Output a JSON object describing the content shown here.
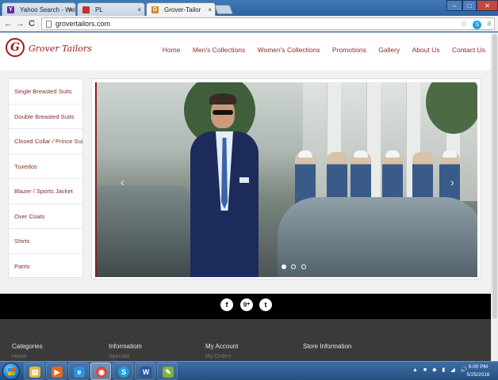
{
  "browser": {
    "tabs": [
      {
        "label": "Yahoo Search - Web Search",
        "favicon_color": "#6c2a9a",
        "favicon_letter": "Y",
        "active": false
      },
      {
        "label": "PL",
        "favicon_color": "#c0312b",
        "favicon_letter": "",
        "active": false
      },
      {
        "label": "Grover-Tailor",
        "favicon_color": "#d18a2a",
        "favicon_letter": "G",
        "active": true
      }
    ],
    "window_controls": {
      "minimize": "–",
      "maximize": "□",
      "close": "✕"
    },
    "nav": {
      "back": "←",
      "forward": "→",
      "reload": "C"
    },
    "url": "grovertailors.com"
  },
  "site": {
    "logo_letter": "G",
    "logo_text": "Grover Tailors",
    "nav": [
      "Home",
      "Men's Collections",
      "Women's Collections",
      "Promotions",
      "Gallery",
      "About Us",
      "Contact Us"
    ],
    "categories": [
      "Single Breasted Suits",
      "Double Breasted Suits",
      "Closed Collar / Prince Suits",
      "Tuxedos",
      "Blazer / Sports Jacket",
      "Over Coats",
      "Shirts",
      "Pants"
    ],
    "slider": {
      "prev": "‹",
      "next": "›",
      "slide_count": 3,
      "active_slide": 1
    },
    "social": [
      {
        "name": "facebook-icon",
        "glyph": "f"
      },
      {
        "name": "google-plus-icon",
        "glyph": "g+"
      },
      {
        "name": "twitter-icon",
        "glyph": "t"
      }
    ],
    "footer": {
      "columns": [
        {
          "heading": "Categories",
          "link": "Home"
        },
        {
          "heading": "Informatioin",
          "link": "Specials"
        },
        {
          "heading": "My Account",
          "link": "My Orders"
        },
        {
          "heading": "Store Information",
          "link": ""
        }
      ]
    }
  },
  "taskbar": {
    "apps": [
      {
        "name": "explorer",
        "glyph": "▤",
        "color": "#e8b64a"
      },
      {
        "name": "media-player",
        "glyph": "▶",
        "color": "#e06a1b"
      },
      {
        "name": "internet-explorer",
        "glyph": "e",
        "color": "#2f8fde"
      },
      {
        "name": "chrome",
        "glyph": "◉",
        "color": "#d64b3b"
      },
      {
        "name": "skype",
        "glyph": "S",
        "color": "#1aa0e2"
      },
      {
        "name": "word",
        "glyph": "W",
        "color": "#2b5797"
      },
      {
        "name": "paint",
        "glyph": "✎",
        "color": "#7cb342"
      }
    ],
    "tray_icons": [
      "▲",
      "■",
      "◆",
      "▮",
      "◢",
      "🔊"
    ],
    "time": "6:00 PM",
    "date": "5/25/2016"
  }
}
